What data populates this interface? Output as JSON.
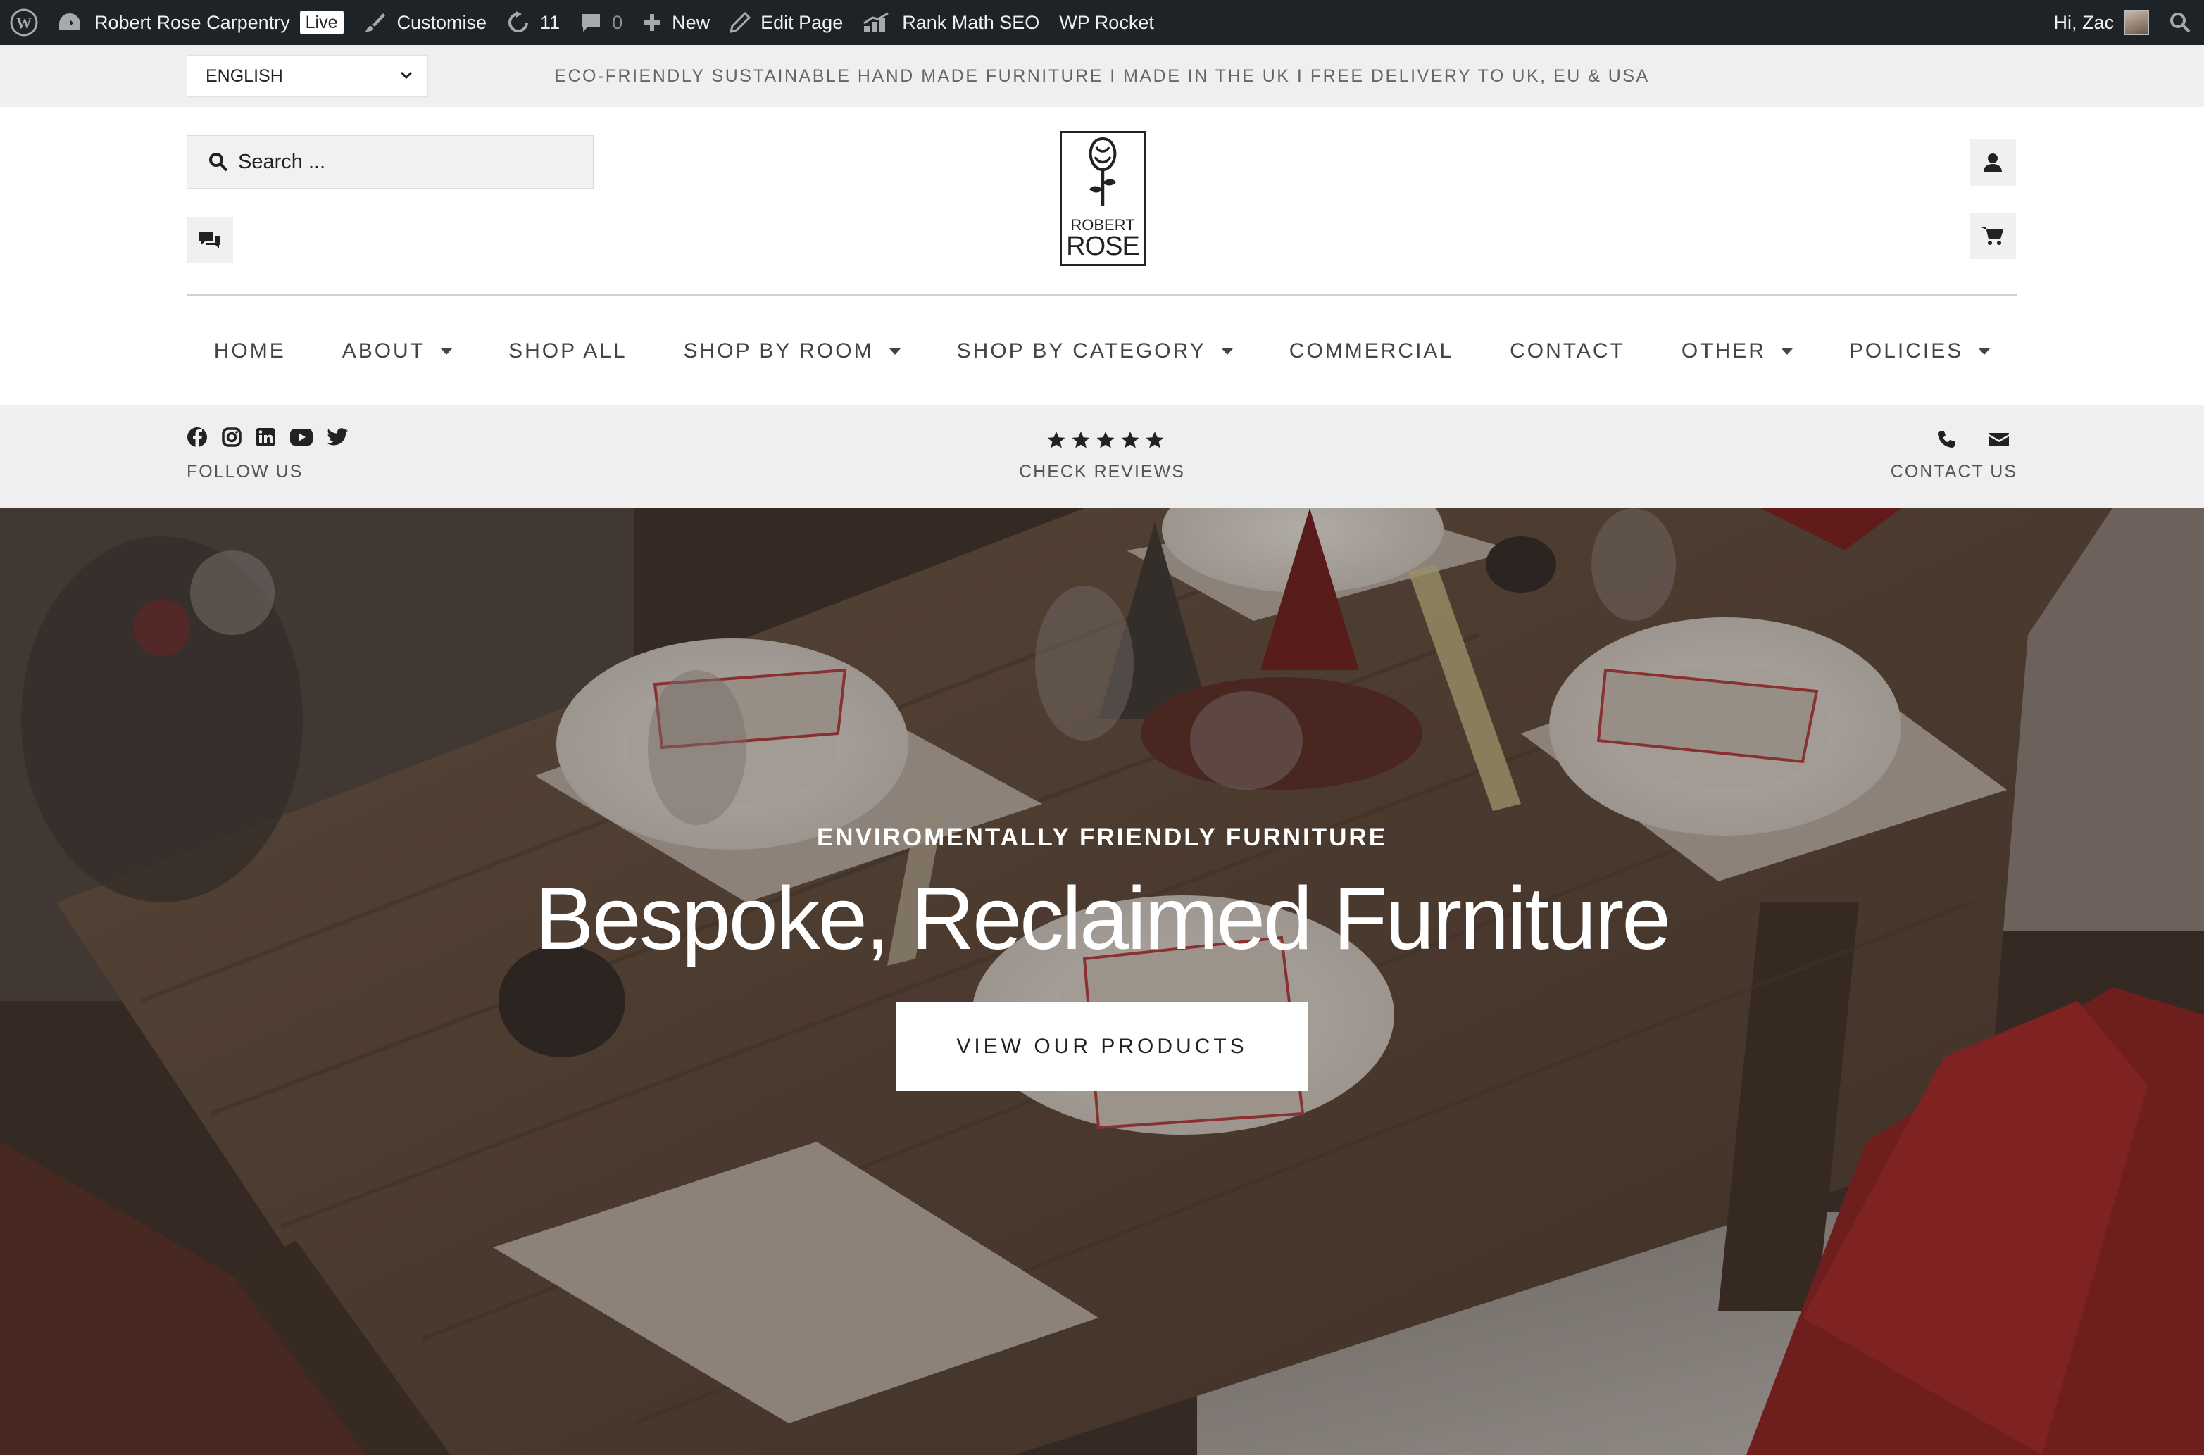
{
  "admin_bar": {
    "site_name": "Robert Rose Carpentry",
    "live_badge": "Live",
    "customise": "Customise",
    "updates_count": "11",
    "comments_count": "0",
    "new": "New",
    "edit_page": "Edit Page",
    "rank_math": "Rank Math SEO",
    "wp_rocket": "WP Rocket",
    "greeting": "Hi, Zac"
  },
  "top_strip": {
    "language": "ENGLISH",
    "tagline": "ECO-FRIENDLY SUSTAINABLE HAND MADE FURNITURE I MADE IN THE UK I FREE DELIVERY TO UK, EU & USA"
  },
  "header": {
    "search_placeholder": "Search ...",
    "logo_line1": "ROBERT",
    "logo_line2": "ROSE"
  },
  "nav": {
    "items": [
      {
        "label": "HOME",
        "dropdown": false
      },
      {
        "label": "ABOUT",
        "dropdown": true
      },
      {
        "label": "SHOP ALL",
        "dropdown": false
      },
      {
        "label": "SHOP BY ROOM",
        "dropdown": true
      },
      {
        "label": "SHOP BY CATEGORY",
        "dropdown": true
      },
      {
        "label": "COMMERCIAL",
        "dropdown": false
      },
      {
        "label": "CONTACT",
        "dropdown": false
      },
      {
        "label": "OTHER",
        "dropdown": true
      },
      {
        "label": "POLICIES",
        "dropdown": true
      }
    ]
  },
  "info_bar": {
    "follow_label": "FOLLOW US",
    "social_icons": [
      "facebook-icon",
      "instagram-icon",
      "linkedin-icon",
      "youtube-icon",
      "twitter-icon"
    ],
    "rating_stars": 5,
    "reviews_label": "CHECK REVIEWS",
    "contact_label": "CONTACT US"
  },
  "hero": {
    "eyebrow": "ENVIROMENTALLY FRIENDLY FURNITURE",
    "title": "Bespoke, Reclaimed Furniture",
    "button": "VIEW OUR PRODUCTS"
  },
  "colors": {
    "admin_bar": "#1d2327",
    "strip": "#efefef",
    "text_dark": "#222222"
  }
}
